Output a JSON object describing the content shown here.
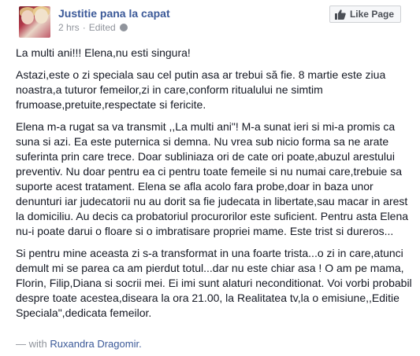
{
  "post": {
    "page_name": "Justitie pana la capat",
    "time": "2 hrs",
    "separator": "·",
    "edited": "Edited",
    "like_button_label": "Like Page",
    "paragraphs": [
      "La multi ani!!! Elena,nu esti singura!",
      "Astazi,este o zi speciala sau cel putin asa ar trebui să fie. 8 martie este ziua noastra,a tuturor femeilor,zi in care,conform ritualului ne simtim frumoase,pretuite,respectate si fericite.",
      "Elena m-a rugat sa va transmit ,,La multi ani\"! M-a sunat ieri si mi-a promis ca suna si azi. Ea este puternica si demna. Nu vrea sub nicio forma sa ne arate suferinta prin care trece. Doar subliniaza ori de cate ori poate,abuzul arestului preventiv. Nu doar pentru ea ci pentru toate femeile si nu numai care,trebuie sa suporte acest tratament. Elena se afla acolo fara probe,doar in baza unor denunturi iar judecatorii nu au dorit sa fie judecata in libertate,sau macar in arest la domiciliu. Au decis ca probatoriul procurorilor este suficient. Pentru asta Elena nu-i poate darui o floare si o imbratisare propriei mame. Este trist si dureros...",
      "Si pentru mine aceasta zi s-a transformat in una foarte trista...o zi in care,atunci demult mi se parea ca am pierdut totul...dar nu este chiar asa ! O am pe mama, Florin, Filip,Diana si socrii mei. Ei imi sunt alaturi neconditionat. Voi vorbi probabil despre toate acestea,diseara la ora 21.00, la Realitatea tv,la o emisiune,,Editie Speciala\",dedicata femeilor."
    ],
    "with_prefix": "— with",
    "tagged_person": "Ruxandra Dragomir."
  }
}
